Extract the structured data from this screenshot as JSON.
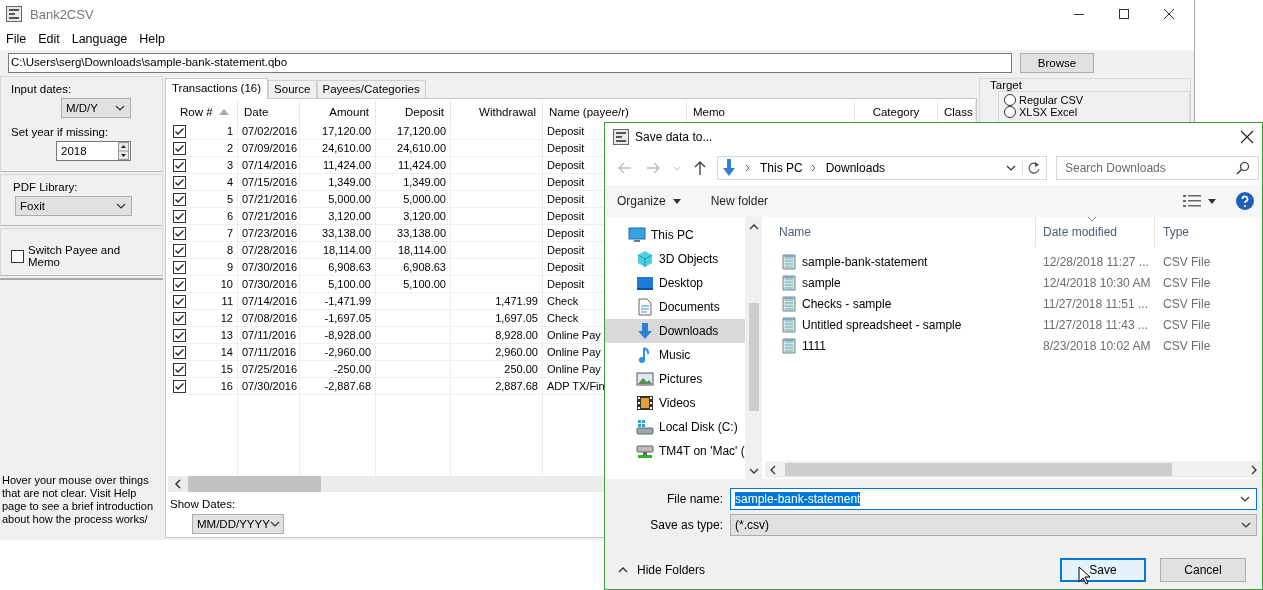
{
  "window": {
    "title": "Bank2CSV",
    "menu": [
      "File",
      "Edit",
      "Language",
      "Help"
    ]
  },
  "path": {
    "value": "C:\\Users\\serg\\Downloads\\sample-bank-statement.qbo",
    "button": "Browse"
  },
  "options": {
    "input_dates_label": "Input dates:",
    "input_dates": "M/D/Y",
    "year_label": "Set year if missing:",
    "year": "2018",
    "pdf_label": "PDF Library:",
    "pdf_library": "Foxit",
    "switch_label": "Switch Payee and Memo",
    "switch_checked": false,
    "help_text": "Hover your mouse over things that are not clear. Visit Help page to see a brief introduction about how the process works/"
  },
  "tabs": [
    {
      "label": "Transactions (16)",
      "selected": true
    },
    {
      "label": "Source",
      "selected": false
    },
    {
      "label": "Payees/Categories",
      "selected": false
    }
  ],
  "table": {
    "columns": [
      {
        "label": "Row #",
        "sorted": true
      },
      {
        "label": "Date",
        "sorted": false
      },
      {
        "label": "Amount",
        "sorted": false
      },
      {
        "label": "Deposit",
        "sorted": false
      },
      {
        "label": "Withdrawal",
        "sorted": false
      },
      {
        "label": "Name (payee/r)",
        "sorted": false
      },
      {
        "label": "Memo",
        "sorted": false
      },
      {
        "label": "Category",
        "sorted": false
      },
      {
        "label": "Class",
        "sorted": false
      }
    ],
    "rows": [
      {
        "checked": true,
        "row": "1",
        "date": "07/02/2016",
        "amount": "17,120.00",
        "deposit": "17,120.00",
        "withdrawal": "",
        "name": "Deposit"
      },
      {
        "checked": true,
        "row": "2",
        "date": "07/09/2016",
        "amount": "24,610.00",
        "deposit": "24,610.00",
        "withdrawal": "",
        "name": "Deposit"
      },
      {
        "checked": true,
        "row": "3",
        "date": "07/14/2016",
        "amount": "11,424.00",
        "deposit": "11,424.00",
        "withdrawal": "",
        "name": "Deposit"
      },
      {
        "checked": true,
        "row": "4",
        "date": "07/15/2016",
        "amount": "1,349.00",
        "deposit": "1,349.00",
        "withdrawal": "",
        "name": "Deposit"
      },
      {
        "checked": true,
        "row": "5",
        "date": "07/21/2016",
        "amount": "5,000.00",
        "deposit": "5,000.00",
        "withdrawal": "",
        "name": "Deposit"
      },
      {
        "checked": true,
        "row": "6",
        "date": "07/21/2016",
        "amount": "3,120.00",
        "deposit": "3,120.00",
        "withdrawal": "",
        "name": "Deposit"
      },
      {
        "checked": true,
        "row": "7",
        "date": "07/23/2016",
        "amount": "33,138.00",
        "deposit": "33,138.00",
        "withdrawal": "",
        "name": "Deposit"
      },
      {
        "checked": true,
        "row": "8",
        "date": "07/28/2016",
        "amount": "18,114.00",
        "deposit": "18,114.00",
        "withdrawal": "",
        "name": "Deposit"
      },
      {
        "checked": true,
        "row": "9",
        "date": "07/30/2016",
        "amount": "6,908.63",
        "deposit": "6,908.63",
        "withdrawal": "",
        "name": "Deposit"
      },
      {
        "checked": true,
        "row": "10",
        "date": "07/30/2016",
        "amount": "5,100.00",
        "deposit": "5,100.00",
        "withdrawal": "",
        "name": "Deposit"
      },
      {
        "checked": true,
        "row": "11",
        "date": "07/14/2016",
        "amount": "-1,471.99",
        "deposit": "",
        "withdrawal": "1,471.99",
        "name": "Check"
      },
      {
        "checked": true,
        "row": "12",
        "date": "07/08/2016",
        "amount": "-1,697.05",
        "deposit": "",
        "withdrawal": "1,697.05",
        "name": "Check"
      },
      {
        "checked": true,
        "row": "13",
        "date": "07/11/2016",
        "amount": "-8,928.00",
        "deposit": "",
        "withdrawal": "8,928.00",
        "name": "Online Pay"
      },
      {
        "checked": true,
        "row": "14",
        "date": "07/11/2016",
        "amount": "-2,960.00",
        "deposit": "",
        "withdrawal": "2,960.00",
        "name": "Online Pay"
      },
      {
        "checked": true,
        "row": "15",
        "date": "07/25/2016",
        "amount": "-250.00",
        "deposit": "",
        "withdrawal": "250.00",
        "name": "Online Pay"
      },
      {
        "checked": true,
        "row": "16",
        "date": "07/30/2016",
        "amount": "-2,887.68",
        "deposit": "",
        "withdrawal": "2,887.68",
        "name": "ADP TX/Fin"
      }
    ]
  },
  "show_dates": {
    "label": "Show Dates:",
    "value": "MM/DD/YYYY"
  },
  "target": {
    "title": "Target",
    "options": [
      {
        "label": "Regular CSV",
        "selected": false
      },
      {
        "label": "XLSX Excel",
        "selected": false
      }
    ]
  },
  "dialog": {
    "title": "Save data to...",
    "breadcrumb": [
      "This PC",
      "Downloads"
    ],
    "search_placeholder": "Search Downloads",
    "toolbar": [
      "Organize",
      "New folder"
    ],
    "nav": [
      {
        "label": "This PC",
        "kind": "pc",
        "selected": false,
        "children": [
          {
            "label": "3D Objects",
            "kind": "objects",
            "selected": false
          },
          {
            "label": "Desktop",
            "kind": "desktop",
            "selected": false
          },
          {
            "label": "Documents",
            "kind": "documents",
            "selected": false
          },
          {
            "label": "Downloads",
            "kind": "downloads",
            "selected": true
          },
          {
            "label": "Music",
            "kind": "music",
            "selected": false
          },
          {
            "label": "Pictures",
            "kind": "pictures",
            "selected": false
          },
          {
            "label": "Videos",
            "kind": "videos",
            "selected": false
          },
          {
            "label": "Local Disk (C:)",
            "kind": "disk",
            "selected": false
          },
          {
            "label": "TM4T on 'Mac' (",
            "kind": "network",
            "selected": false
          }
        ]
      }
    ],
    "columns": [
      "Name",
      "Date modified",
      "Type"
    ],
    "files": [
      {
        "name": "sample-bank-statement",
        "date": "12/28/2018 11:27 ...",
        "type": "CSV File"
      },
      {
        "name": "sample",
        "date": "12/4/2018 10:30 AM",
        "type": "CSV File"
      },
      {
        "name": "Checks - sample",
        "date": "11/27/2018 11:51 ...",
        "type": "CSV File"
      },
      {
        "name": "Untitled spreadsheet - sample",
        "date": "11/27/2018 11:43 ...",
        "type": "CSV File"
      },
      {
        "name": "1111",
        "date": "8/23/2018 10:02 AM",
        "type": "CSV File"
      }
    ],
    "file_name_label": "File name:",
    "file_name": "sample-bank-statement",
    "file_name_selected": true,
    "type_label": "Save as type:",
    "type_value": "(*.csv)",
    "hide_folders": "Hide Folders",
    "buttons": [
      {
        "label": "Save",
        "kind": "primary"
      },
      {
        "label": "Cancel",
        "kind": "normal"
      }
    ]
  }
}
